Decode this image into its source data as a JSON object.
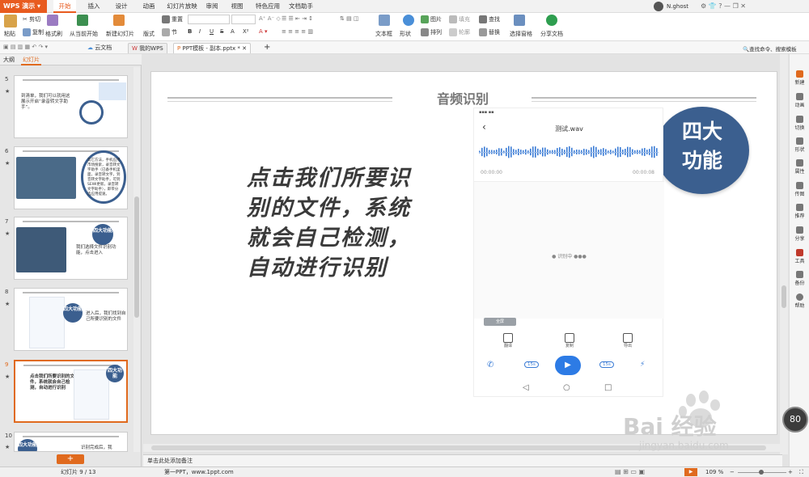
{
  "app": {
    "name": "WPS 演示",
    "user": "N.ghost"
  },
  "menu_tabs": [
    "开始",
    "插入",
    "设计",
    "动画",
    "幻灯片放映",
    "审阅",
    "视图",
    "特色应用",
    "文档助手"
  ],
  "ribbon": {
    "paste": "粘贴",
    "cut": "剪切",
    "copy": "复制",
    "format_painter": "格式刷",
    "from_current": "从当前开始",
    "new_slide": "新建幻灯片",
    "layout": "版式",
    "section": "节",
    "reset": "重置",
    "font_bold": "B",
    "font_italic": "I",
    "font_underline": "U",
    "font_strike": "S",
    "font_shadow": "A",
    "font_super": "X²",
    "text_box": "文本框",
    "shape": "形状",
    "picture": "图片",
    "arrange": "排列",
    "fill": "填充",
    "outline": "轮廓",
    "find": "查找",
    "replace": "替换",
    "select_pane": "选择窗格",
    "share_doc": "分享文档"
  },
  "quickbar": {
    "cloud_doc": "云文档",
    "my_wps": "我的WPS",
    "doc_tab": "PPT模板 - 副本.pptx *",
    "search": "查找命令、搜索模板"
  },
  "left_panel": {
    "tab_outline": "大纲",
    "tab_slides": "幻灯片",
    "thumbs": [
      {
        "num": "5",
        "text": "到清单，我们可以就用这展示开启“录音转文字助手”。"
      },
      {
        "num": "6",
        "text": "其它方法，手机应用市场搜索，录音转文字助手（已备手机里面，录音转文字，到音转文字助手，可到SEWI更新。录音转文字助手），即带分选应用提速。"
      },
      {
        "num": "7",
        "text": "我们选择文件识别功能，点击进入",
        "badge": "四大功能"
      },
      {
        "num": "8",
        "text": "进入后，我们找到自己所要识别的文件",
        "badge": "四大功能"
      },
      {
        "num": "9",
        "text": "点击我们所要识别的文件，系统就会自己检测，自动进行识别",
        "badge": "四大功能"
      },
      {
        "num": "10",
        "text": "识别完成后，我",
        "badge": "四大功能"
      }
    ],
    "add_button": "+"
  },
  "slide": {
    "title": "音频识别",
    "body": "点击我们所要识别的文件，系统就会自己检测，自动进行识别",
    "badge_line1": "四大",
    "badge_line2": "功能",
    "phone": {
      "file_name": "测试.wav",
      "time_start": "00:00:00",
      "time_end": "00:00:08",
      "recognizing": "● 识别中 ●●●",
      "pill": "全屏",
      "action_translate": "翻译",
      "action_copy": "复制",
      "action_export": "导出",
      "speed_left": "15s",
      "speed_right": "15s"
    }
  },
  "notes_placeholder": "单击此处添加备注",
  "status": {
    "slide_counter": "幻灯片 9 / 13",
    "theme": "第一PPT，www.1ppt.com",
    "zoom": "109 %"
  },
  "right_sidebar": [
    "新建",
    "动画",
    "切换",
    "形状",
    "属性",
    "传图",
    "推荐",
    "分享",
    "工具",
    "备份",
    "帮助"
  ],
  "watermark": {
    "brand": "Bai 经验",
    "url": "jingyan.baidu.com",
    "badge": "80"
  }
}
